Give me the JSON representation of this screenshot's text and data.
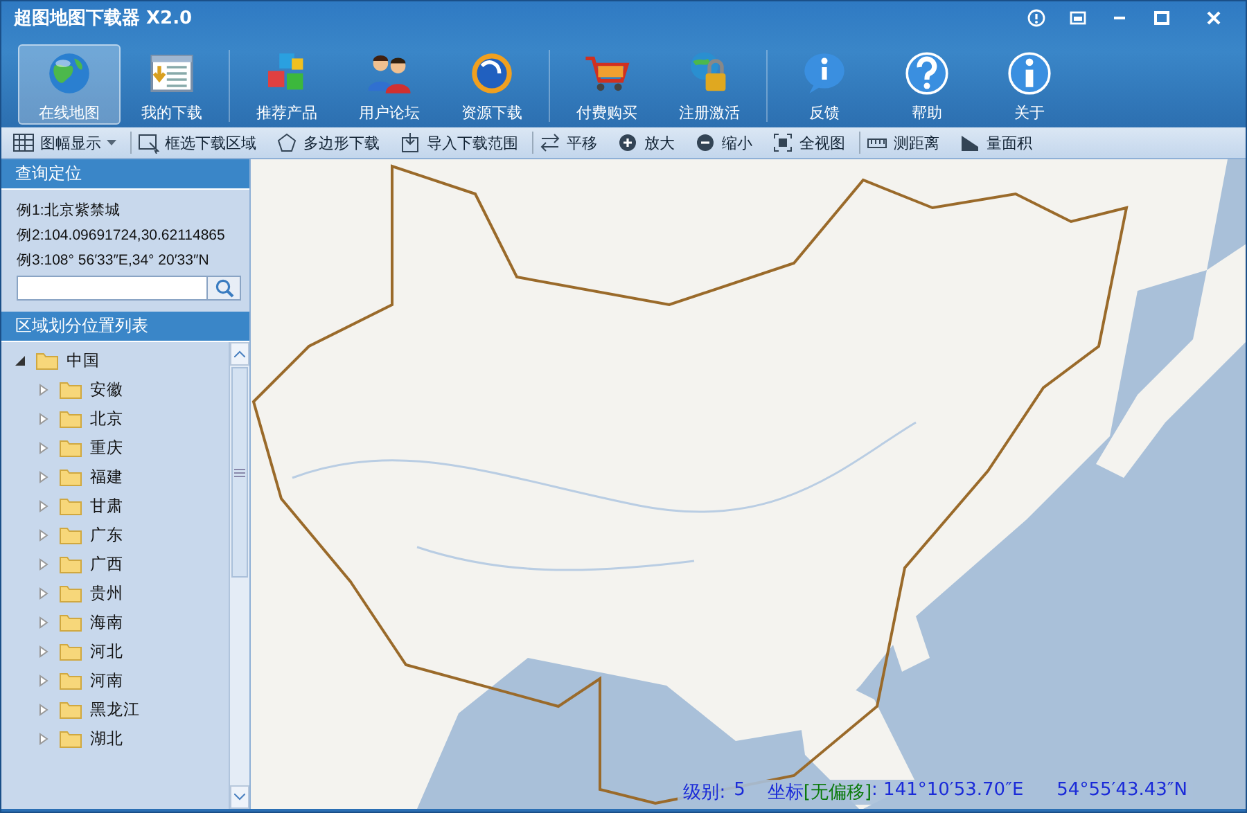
{
  "window": {
    "title": "超图地图下载器 X2.0",
    "controls": [
      {
        "kind": "info"
      },
      {
        "kind": "restore"
      },
      {
        "kind": "minimize"
      },
      {
        "kind": "maximize"
      },
      {
        "kind": "close"
      }
    ]
  },
  "main_toolbar": [
    {
      "label": "在线地图",
      "kind": "globe",
      "selected": true
    },
    {
      "label": "我的下载",
      "kind": "list",
      "selected": false
    },
    {
      "label": "推荐产品",
      "kind": "cubes",
      "selected": false,
      "separator_before": true
    },
    {
      "label": "用户论坛",
      "kind": "people",
      "selected": false
    },
    {
      "label": "资源下载",
      "kind": "disc",
      "selected": false
    },
    {
      "label": "付费购买",
      "kind": "cart",
      "selected": false,
      "separator_before": true
    },
    {
      "label": "注册激活",
      "kind": "lock",
      "selected": false
    },
    {
      "label": "反馈",
      "kind": "bubble",
      "selected": false,
      "separator_before": true
    },
    {
      "label": "帮助",
      "kind": "help",
      "selected": false
    },
    {
      "label": "关于",
      "kind": "about",
      "selected": false
    }
  ],
  "map_toolbar": [
    {
      "label": "图幅显示",
      "kind": "grid",
      "dropdown": true
    },
    {
      "label": "框选下载区域",
      "kind": "select",
      "separator_before": true
    },
    {
      "label": "多边形下载",
      "kind": "polygon"
    },
    {
      "label": "导入下载范围",
      "kind": "import"
    },
    {
      "label": "平移",
      "kind": "pan",
      "separator_before": true
    },
    {
      "label": "放大",
      "kind": "zoomin"
    },
    {
      "label": "缩小",
      "kind": "zoomout"
    },
    {
      "label": "全视图",
      "kind": "fullview"
    },
    {
      "label": "测距离",
      "kind": "ruler",
      "separator_before": true
    },
    {
      "label": "量面积",
      "kind": "area"
    }
  ],
  "sidebar": {
    "search_title": "查询定位",
    "examples": [
      "例1:北京紫禁城",
      "例2:104.09691724,30.62114865",
      "例3:108° 56′33″E,34° 20′33″N"
    ],
    "region_title": "区域划分位置列表",
    "tree": [
      {
        "label": "中国",
        "expanded": true,
        "children": [
          {
            "label": "安徽",
            "expanded": false
          },
          {
            "label": "北京",
            "expanded": false
          },
          {
            "label": "重庆",
            "expanded": false
          },
          {
            "label": "福建",
            "expanded": false
          },
          {
            "label": "甘肃",
            "expanded": false
          },
          {
            "label": "广东",
            "expanded": false
          },
          {
            "label": "广西",
            "expanded": false
          },
          {
            "label": "贵州",
            "expanded": false
          },
          {
            "label": "海南",
            "expanded": false
          },
          {
            "label": "河北",
            "expanded": false
          },
          {
            "label": "河南",
            "expanded": false
          },
          {
            "label": "黑龙江",
            "expanded": false
          },
          {
            "label": "湖北",
            "expanded": false
          }
        ]
      }
    ]
  },
  "status_bar": {
    "level_label": "级别:",
    "level_value": "5",
    "coord_label": "坐标",
    "offset_tag": "[无偏移]",
    "longitude": ": 141°10′53.70″E",
    "latitude": "54°55′43.43″N"
  }
}
